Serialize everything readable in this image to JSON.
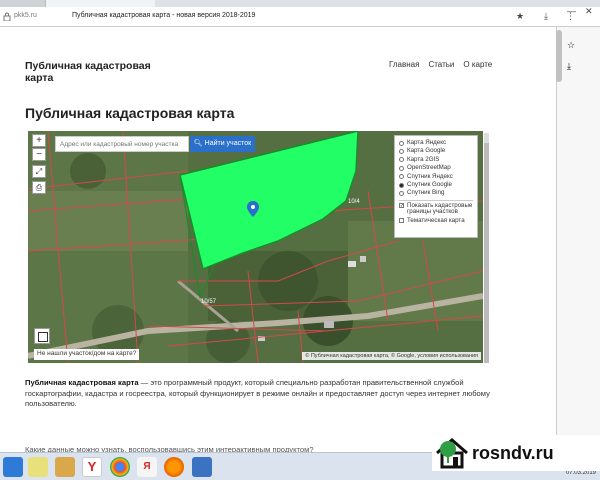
{
  "browser": {
    "domain": "pkk5.ru",
    "page_title": "Публичная кадастровая карта - новая версия 2018-2019"
  },
  "site": {
    "title": "Публичная кадастровая карта",
    "nav": [
      "Главная",
      "Статьи",
      "О карте"
    ]
  },
  "main": {
    "heading": "Публичная кадастровая карта"
  },
  "map": {
    "search_placeholder": "Адрес или кадастровый номер участка",
    "search_button": "Найти участок",
    "zoom_in": "+",
    "zoom_out": "−",
    "parcel_label": "10/57",
    "parcel_label2": "10/4",
    "layers": [
      {
        "label": "Карта Яндекс",
        "selected": false
      },
      {
        "label": "Карта Google",
        "selected": false
      },
      {
        "label": "Карта 2GIS",
        "selected": false
      },
      {
        "label": "OpenStreetMap",
        "selected": false
      },
      {
        "label": "Спутник Яндекс",
        "selected": false
      },
      {
        "label": "Спутник Google",
        "selected": true
      },
      {
        "label": "Спутник Bing",
        "selected": false
      }
    ],
    "overlays": [
      {
        "label": "Показать кадастровые границы участков",
        "checked": true
      },
      {
        "label": "Тематическая карта",
        "checked": false
      }
    ],
    "help_link": "Не нашли участок/дом на карте?",
    "attribution": "© Публичная кадастровая карта, © Google, условия использования"
  },
  "article": {
    "bold_lead": "Публичная кадастровая карта",
    "text": " — это программный продукт, который специально разработан правительственной службой госкартографии, кадастра и госреестра, который функционирует в режиме онлайн и предоставляет доступ через интернет любому пользователю.",
    "next_question": "Какие данные можно узнать, воспользовавшись этим интерактивным продуктом?"
  },
  "taskbar": {
    "date": "07.03.2019"
  },
  "watermark": {
    "text": "rosndv.ru"
  },
  "colors": {
    "parcel_fill": "#22ff66",
    "button_blue": "#2a6fc9",
    "boundary": "#d24a4a"
  }
}
